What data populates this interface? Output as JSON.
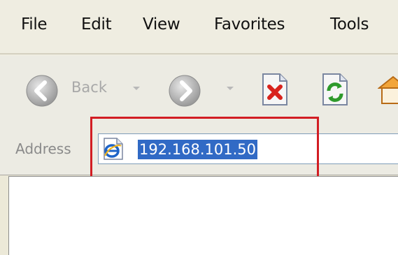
{
  "menubar": {
    "items": [
      {
        "label": "File"
      },
      {
        "label": "Edit"
      },
      {
        "label": "View"
      },
      {
        "label": "Favorites"
      },
      {
        "label": "Tools"
      }
    ]
  },
  "toolbar": {
    "back_label": "Back",
    "icons": [
      "back-arrow-icon",
      "forward-arrow-icon",
      "stop-icon",
      "refresh-icon",
      "home-icon"
    ]
  },
  "addressbar": {
    "label": "Address",
    "url": "192.168.101.50",
    "page_icon": "ie-page-icon"
  },
  "annotation": {
    "highlight_color": "#d21d23"
  }
}
